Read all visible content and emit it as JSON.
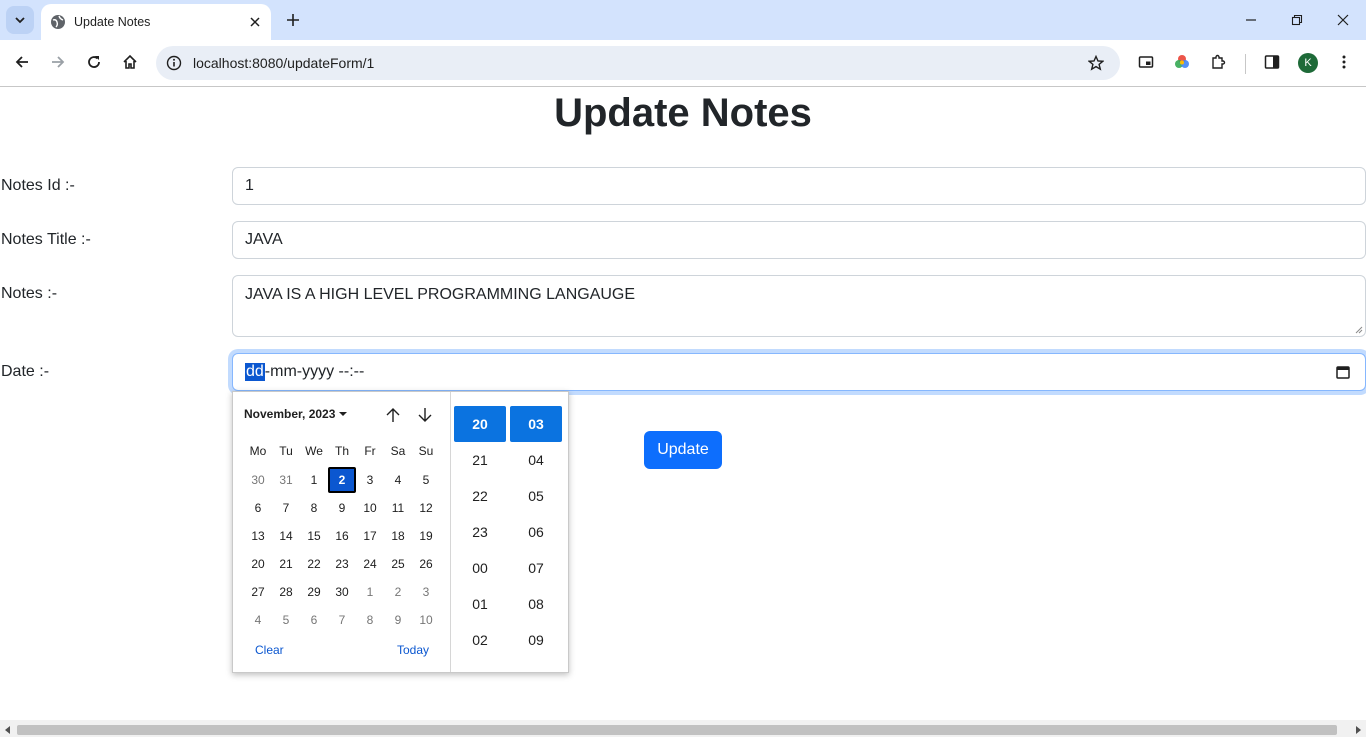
{
  "browser": {
    "tab_title": "Update Notes",
    "url": "localhost:8080/updateForm/1",
    "profile_initial": "K"
  },
  "page": {
    "title": "Update Notes",
    "labels": {
      "notes_id": "Notes Id :-",
      "notes_title": "Notes Title :-",
      "notes": "Notes :-",
      "date": "Date :-"
    },
    "values": {
      "notes_id": "1",
      "notes_title": "JAVA",
      "notes": "JAVA IS A HIGH LEVEL PROGRAMMING LANGAUGE"
    },
    "date_segments": {
      "dd": "dd",
      "rest": "-mm-yyyy --:--"
    },
    "update_button": "Update"
  },
  "picker": {
    "month_label": "November, 2023",
    "weekdays": [
      "Mo",
      "Tu",
      "We",
      "Th",
      "Fr",
      "Sa",
      "Su"
    ],
    "weeks": [
      [
        "30",
        "31",
        "1",
        "2",
        "3",
        "4",
        "5"
      ],
      [
        "6",
        "7",
        "8",
        "9",
        "10",
        "11",
        "12"
      ],
      [
        "13",
        "14",
        "15",
        "16",
        "17",
        "18",
        "19"
      ],
      [
        "20",
        "21",
        "22",
        "23",
        "24",
        "25",
        "26"
      ],
      [
        "27",
        "28",
        "29",
        "30",
        "1",
        "2",
        "3"
      ],
      [
        "4",
        "5",
        "6",
        "7",
        "8",
        "9",
        "10"
      ]
    ],
    "selected_day": "2",
    "clear_label": "Clear",
    "today_label": "Today",
    "hours": [
      "20",
      "21",
      "22",
      "23",
      "00",
      "01",
      "02"
    ],
    "minutes": [
      "03",
      "04",
      "05",
      "06",
      "07",
      "08",
      "09"
    ],
    "selected_hour": "20",
    "selected_minute": "03"
  },
  "colors": {
    "accent": "#0d6efd",
    "chrome_tabstrip": "#d3e3fd",
    "selection": "#0b57d0"
  }
}
